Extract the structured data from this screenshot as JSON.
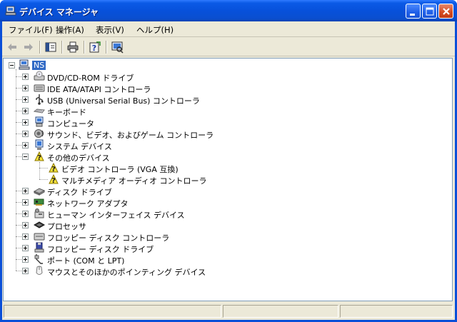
{
  "window": {
    "title": "デバイス マネージャ"
  },
  "menubar": {
    "items": [
      {
        "label": "ファイル(F)"
      },
      {
        "label": "操作(A)"
      },
      {
        "label": "表示(V)"
      },
      {
        "label": "ヘルプ(H)"
      }
    ]
  },
  "toolbar": {
    "buttons": [
      "back-arrow-icon",
      "forward-arrow-icon",
      "show-hide-tree-icon",
      "print-icon",
      "help-icon",
      "scan-hardware-icon"
    ]
  },
  "tree": {
    "root": "NS",
    "items": [
      {
        "label": "DVD/CD-ROM ドライブ",
        "icon": "dvd-drive-icon",
        "expanded": false
      },
      {
        "label": "IDE ATA/ATAPI コントローラ",
        "icon": "ide-controller-icon",
        "expanded": false
      },
      {
        "label": "USB (Universal Serial Bus) コントローラ",
        "icon": "usb-icon",
        "expanded": false
      },
      {
        "label": "キーボード",
        "icon": "keyboard-icon",
        "expanded": false
      },
      {
        "label": "コンピュータ",
        "icon": "computer-icon",
        "expanded": false
      },
      {
        "label": "サウンド、ビデオ、およびゲーム コントローラ",
        "icon": "sound-icon",
        "expanded": false
      },
      {
        "label": "システム デバイス",
        "icon": "system-device-icon",
        "expanded": false
      },
      {
        "label": "その他のデバイス",
        "icon": "unknown-device-icon",
        "expanded": true,
        "children": [
          {
            "label": "ビデオ コントローラ (VGA 互換)",
            "icon": "unknown-device-icon"
          },
          {
            "label": "マルチメディア オーディオ コントローラ",
            "icon": "unknown-device-icon"
          }
        ]
      },
      {
        "label": "ディスク ドライブ",
        "icon": "disk-drive-icon",
        "expanded": false
      },
      {
        "label": "ネットワーク アダプタ",
        "icon": "network-adapter-icon",
        "expanded": false
      },
      {
        "label": "ヒューマン インターフェイス デバイス",
        "icon": "hid-icon",
        "expanded": false
      },
      {
        "label": "プロセッサ",
        "icon": "processor-icon",
        "expanded": false
      },
      {
        "label": "フロッピー ディスク コントローラ",
        "icon": "floppy-controller-icon",
        "expanded": false
      },
      {
        "label": "フロッピー ディスク ドライブ",
        "icon": "floppy-drive-icon",
        "expanded": false
      },
      {
        "label": "ポート (COM と LPT)",
        "icon": "port-icon",
        "expanded": false
      },
      {
        "label": "マウスとそのほかのポインティング デバイス",
        "icon": "mouse-icon",
        "expanded": false
      }
    ]
  },
  "colors": {
    "titlebar": "#0751db",
    "selection": "#316ac5",
    "face": "#ece9d8"
  }
}
